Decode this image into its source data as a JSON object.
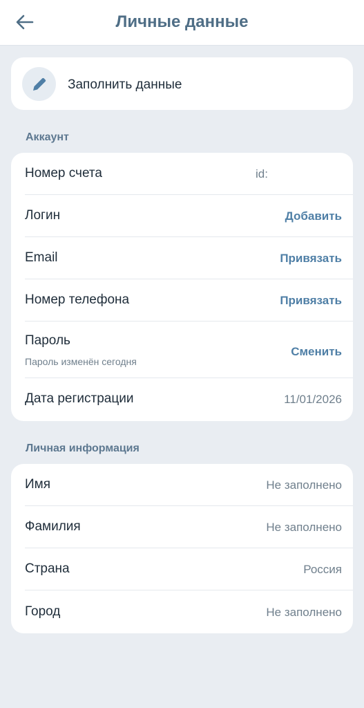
{
  "header": {
    "title": "Личные данные",
    "back_icon": "arrow-left-icon"
  },
  "fill_card": {
    "label": "Заполнить данные",
    "icon": "pencil-icon"
  },
  "account": {
    "section_title": "Аккаунт",
    "account_number": {
      "label": "Номер счета",
      "value": "id:"
    },
    "login": {
      "label": "Логин",
      "action": "Добавить"
    },
    "email": {
      "label": "Email",
      "action": "Привязать"
    },
    "phone": {
      "label": "Номер телефона",
      "action": "Привязать"
    },
    "password": {
      "label": "Пароль",
      "sub": "Пароль изменён сегодня",
      "action": "Сменить"
    },
    "registration": {
      "label": "Дата регистрации",
      "value": "11/01/2026"
    }
  },
  "personal": {
    "section_title": "Личная информация",
    "first_name": {
      "label": "Имя",
      "value": "Не заполнено"
    },
    "last_name": {
      "label": "Фамилия",
      "value": "Не заполнено"
    },
    "country": {
      "label": "Страна",
      "value": "Россия"
    },
    "city": {
      "label": "Город",
      "value": "Не заполнено"
    }
  },
  "colors": {
    "background": "#e9edf2",
    "card": "#ffffff",
    "accent": "#4f7fa6",
    "title": "#4f6e86"
  }
}
